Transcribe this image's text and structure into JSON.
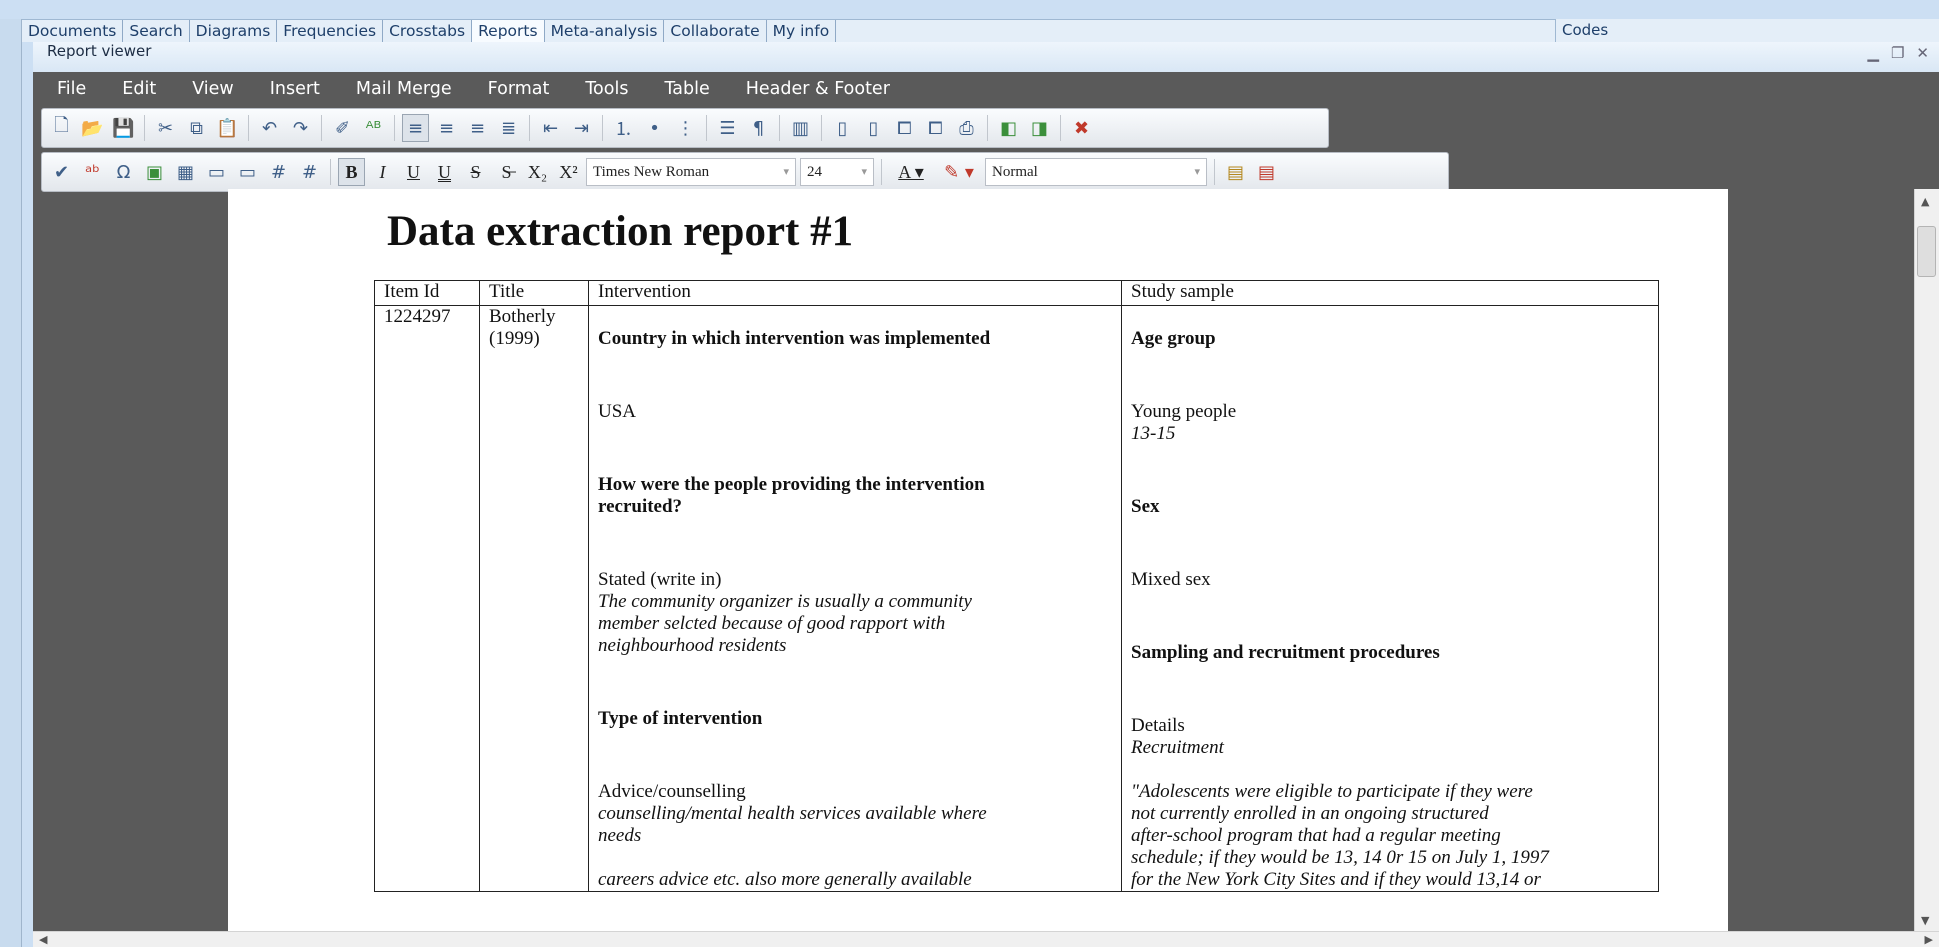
{
  "main_tabs": [
    "Documents",
    "Search",
    "Diagrams",
    "Frequencies",
    "Crosstabs",
    "Reports",
    "Meta-analysis",
    "Collaborate",
    "My info"
  ],
  "codes_label": "Codes",
  "window": {
    "title": "Report viewer"
  },
  "menu": [
    "File",
    "Edit",
    "View",
    "Insert",
    "Mail Merge",
    "Format",
    "Tools",
    "Table",
    "Header & Footer"
  ],
  "format": {
    "font": "Times New Roman",
    "size": "24",
    "style": "Normal"
  },
  "report": {
    "title": "Data extraction report #1",
    "headers": [
      "Item Id",
      "Title",
      "Intervention",
      "Study sample"
    ],
    "item_id": "1224297",
    "item_title": [
      "Botherly",
      "(1999)"
    ],
    "intervention": {
      "q1": "Country in which intervention was implemented",
      "a1": "USA",
      "q2": [
        "How were the people providing the intervention",
        "recruited?"
      ],
      "a2": "Stated (write in)",
      "a2_note": [
        "The community organizer is usually a community",
        "member selcted because of good rapport with",
        "neighbourhood residents"
      ],
      "q3": "Type of intervention",
      "a3": "Advice/counselling",
      "a3_note": [
        "counselling/mental health services available where",
        "needs"
      ],
      "a3_note2": "careers advice etc. also more generally available"
    },
    "sample": {
      "q1": "Age group",
      "a1": "Young people",
      "a1_note": "13-15",
      "q2": "Sex",
      "a2": "Mixed sex",
      "q3": "Sampling and recruitment procedures",
      "a3": "Details",
      "a3_note": "Recruitment",
      "quote": [
        "\"Adolescents were eligible to participate if they were",
        "not currently enrolled in an ongoing structured",
        "after-school program that had a regular meeting",
        "schedule; if they would be 13, 14 0r 15 on July 1, 1997",
        "for the New York City Sites and if they would 13,14 or"
      ]
    }
  }
}
